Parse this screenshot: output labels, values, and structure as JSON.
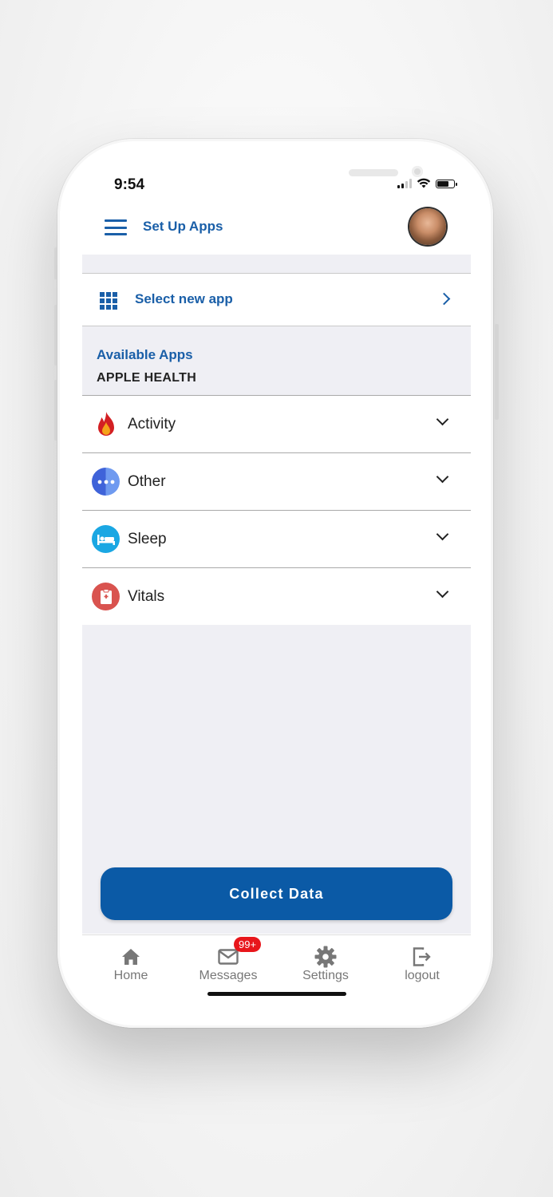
{
  "status_bar": {
    "time": "9:54"
  },
  "header": {
    "title": "Set Up Apps",
    "menu_icon": "hamburger-menu-icon",
    "avatar_icon": "user-avatar"
  },
  "select_app": {
    "label": "Select new app",
    "icon": "grid-icon",
    "chevron": "chevron-right-icon"
  },
  "available": {
    "heading": "Available Apps",
    "source": "APPLE HEALTH"
  },
  "categories": [
    {
      "label": "Activity",
      "icon": "flame-icon",
      "color": "#d31f23"
    },
    {
      "label": "Other",
      "icon": "more-dots-icon",
      "color": "#4a78e8"
    },
    {
      "label": "Sleep",
      "icon": "bed-icon",
      "color": "#1aa7e3"
    },
    {
      "label": "Vitals",
      "icon": "clipboard-icon",
      "color": "#d9534f"
    }
  ],
  "collect_button": {
    "label": "Collect Data",
    "color": "#0b5aa6"
  },
  "tabbar": {
    "items": [
      {
        "label": "Home",
        "icon": "home-icon"
      },
      {
        "label": "Messages",
        "icon": "mail-icon",
        "badge": "99+"
      },
      {
        "label": "Settings",
        "icon": "gear-icon"
      },
      {
        "label": "logout",
        "icon": "logout-icon"
      }
    ]
  },
  "accent_color": "#1a5fa8"
}
